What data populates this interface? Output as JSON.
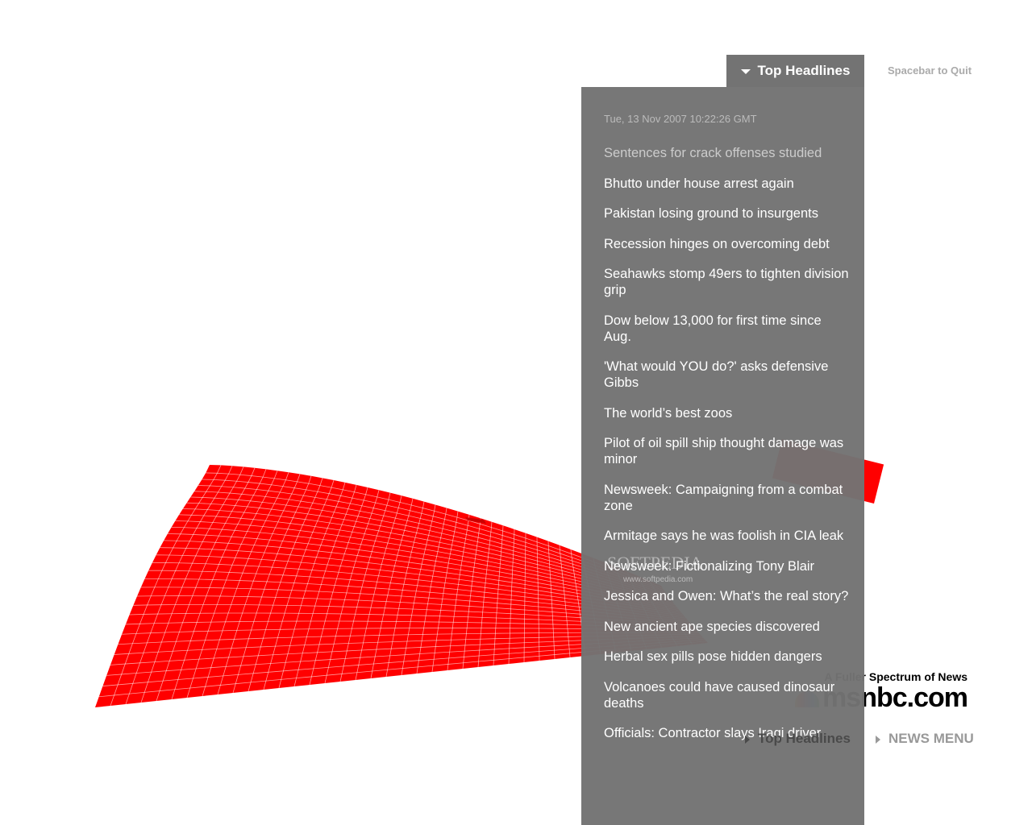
{
  "header": {
    "tab_label": "Top Headlines",
    "quit_hint": "Spacebar to Quit"
  },
  "panel": {
    "date": "Tue, 13 Nov 2007 10:22:26 GMT",
    "headlines": [
      "Sentences for crack offenses studied",
      "Bhutto under house arrest again",
      "Pakistan losing ground to insurgents",
      "Recession hinges on overcoming debt",
      "Seahawks stomp 49ers to tighten division grip",
      "Dow below 13,000 for first time since Aug.",
      "'What would YOU do?' asks defensive Gibbs",
      "The world’s best zoos",
      "Pilot of oil spill ship thought damage was minor",
      "Newsweek: Campaigning from a combat zone",
      "Armitage says he was foolish in CIA leak",
      "Newsweek: Fictionalizing Tony Blair",
      "Jessica and Owen: What’s the real story?",
      "New ancient ape species discovered",
      "Herbal sex pills pose hidden dangers",
      "Volcanoes could have caused dinosaur deaths",
      "Officials: Contractor slays Iraqi driver"
    ]
  },
  "brand": {
    "tagline": "A Fuller Spectrum of News",
    "logo": "msnbc.com"
  },
  "footer": {
    "top_headlines": "Top Headlines",
    "news_menu": "NEWS MENU"
  },
  "watermark": {
    "name": "SOFTPEDIA",
    "url": "www.softpedia.com"
  },
  "colors": {
    "accent": "#ff0000",
    "panel": "#737373"
  }
}
